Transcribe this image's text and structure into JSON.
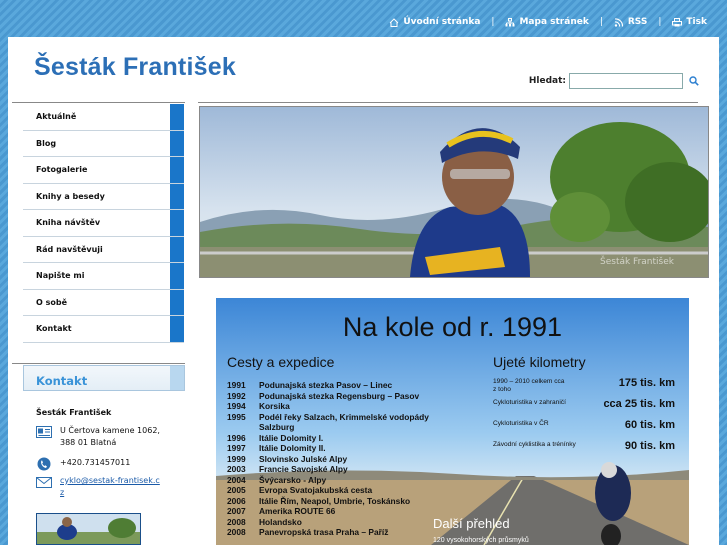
{
  "topnav": {
    "home": "Úvodní stránka",
    "sitemap": "Mapa stránek",
    "rss": "RSS",
    "print": "Tisk",
    "separator": "|"
  },
  "site": {
    "title": "Šesták František"
  },
  "search": {
    "label": "Hledat:",
    "value": ""
  },
  "menu": {
    "items": [
      {
        "label": "Aktuálně"
      },
      {
        "label": "Blog"
      },
      {
        "label": "Fotogalerie"
      },
      {
        "label": "Knihy a besedy"
      },
      {
        "label": "Kniha návštěv"
      },
      {
        "label": "Rád navštěvuji"
      },
      {
        "label": "Napište mi"
      },
      {
        "label": "O sobě"
      },
      {
        "label": "Kontakt"
      }
    ]
  },
  "contact": {
    "heading": "Kontakt",
    "name": "Šesták František",
    "address_line1": "U Čertova kamene 1062,",
    "address_line2": "388 01 Blatná",
    "phone": "+420.731457011",
    "email_line1": "cyklo@sestak-frantisek.c",
    "email_line2": "z"
  },
  "poster": {
    "title": "Na kole od r. 1991",
    "left_heading": "Cesty a expedice",
    "right_heading": "Ujeté kilometry",
    "trips": [
      {
        "year": "1991",
        "text": "Podunajská stezka Pasov – Linec"
      },
      {
        "year": "1992",
        "text": "Podunajská stezka Regensburg – Pasov"
      },
      {
        "year": "1994",
        "text": "Korsika"
      },
      {
        "year": "1995",
        "text": "Podél řeky Salzach,  Krimmelské vodopády"
      },
      {
        "year": "",
        "text": "Salzburg"
      },
      {
        "year": "1996",
        "text": "Itálie Dolomity I."
      },
      {
        "year": "1997",
        "text": "Itálie  Dolomity II."
      },
      {
        "year": "1999",
        "text": "Slovinsko    Julské Alpy"
      },
      {
        "year": "2003",
        "text": "Francie    Savojské Alpy"
      },
      {
        "year": "2004",
        "text": "Švýcarsko - Alpy"
      },
      {
        "year": "2005",
        "text": "Evropa    Svatojakubská cesta"
      },
      {
        "year": "2006",
        "text": "Itálie         Řím, Neapol, Umbrie, Toskánsko"
      },
      {
        "year": "2007",
        "text": "Amerika   ROUTE 66"
      },
      {
        "year": "2008",
        "text": "Holandsko"
      },
      {
        "year": "2008",
        "text": "Panevropská trasa Praha – Paříž"
      }
    ],
    "kilometers": [
      {
        "label": "1990 – 2010  celkem cca\nz toho",
        "value": "175 tis. km"
      },
      {
        "label": "Cykloturistika v zahraničí",
        "value": "cca 25 tis. km"
      },
      {
        "label": "Cykloturistika v ČR",
        "value": "60 tis. km"
      },
      {
        "label": "Závodní cyklistika a trénínky",
        "value": "90 tis. km"
      }
    ],
    "more": "Další přehled",
    "more_sub": "120 vysokohorských průsmyků"
  },
  "colors": {
    "accent": "#1a76c9",
    "title": "#2c6fb6",
    "background": "#4f9fd6"
  }
}
